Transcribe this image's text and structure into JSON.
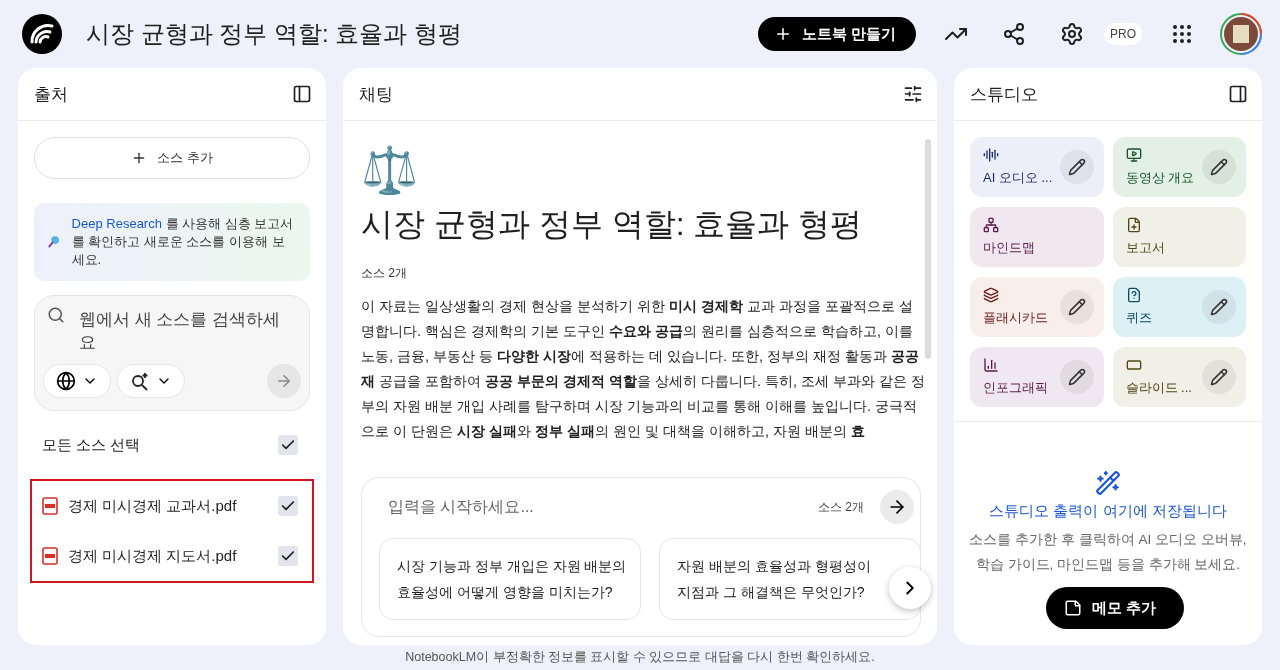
{
  "header": {
    "title": "시장 균형과 정부 역할: 효율과 형평",
    "create_button": "노트북 만들기",
    "badge": "PRO"
  },
  "sources_panel": {
    "title": "출처",
    "add_button": "소스 추가",
    "promo": {
      "link": "Deep Research",
      "text": " 를 사용해 심층 보고서를 확인하고 새로운 소스를 이용해 보세요."
    },
    "search": {
      "placeholder": "웹에서 새 소스를 검색하세요"
    },
    "select_all": {
      "label": "모든 소스 선택",
      "checked": true
    },
    "highlighted": true,
    "sources": [
      {
        "name": "경제 미시경제 교과서.pdf",
        "checked": true
      },
      {
        "name": "경제 미시경제 지도서.pdf",
        "checked": true
      }
    ]
  },
  "chat_panel": {
    "title": "채팅",
    "emoji": "⚖️",
    "notebook_title": "시장 균형과 정부 역할: 효율과 형평",
    "source_count": "소스 2개",
    "summary": "이 자료는 일상생활의 경제 현상을 분석하기 위한 **미시 경제학** 교과 과정을 포괄적으로 설명합니다. 핵심은 경제학의 기본 도구인 **수요와 공급**의 원리를 심층적으로 학습하고, 이를 노동, 금융, 부동산 등 **다양한 시장**에 적용하는 데 있습니다. 또한, 정부의 재정 활동과 **공공재** 공급을 포함하여 **공공 부문의 경제적 역할**을 상세히 다룹니다. 특히, 조세 부과와 같은 정부의 자원 배분 개입 사례를 탐구하며 시장 기능과의 비교를 통해 이해를 높입니다. 궁극적으로 이 단원은 **시장 실패**와 **정부 실패**의 원인 및 대책을 이해하고, 자원 배분의 **효**",
    "input": {
      "placeholder": "입력을 시작하세요...",
      "source_count": "소스 2개"
    },
    "suggestions": [
      {
        "lines": [
          "시장 기능과 정부 개입은 자원 배분의",
          "효율성에 어떻게 영향을 미치는가?"
        ]
      },
      {
        "lines": [
          "자원 배분의 효율성과 형평성이",
          "지점과 그 해결책은 무엇인가?"
        ]
      }
    ]
  },
  "studio_panel": {
    "title": "스튜디오",
    "tiles": [
      {
        "kind": "audio",
        "label": "AI 오디오 ...",
        "color": "#eceef9",
        "editable": true
      },
      {
        "kind": "video",
        "label": "동영상 개요",
        "color": "#e3f0e5",
        "editable": true
      },
      {
        "kind": "mindmap",
        "label": "마인드맵",
        "color": "#f1e8ef",
        "editable": false
      },
      {
        "kind": "report",
        "label": "보고서",
        "color": "#f1f0e6",
        "editable": false
      },
      {
        "kind": "flashcards",
        "label": "플래시카드",
        "color": "#f8eeea",
        "editable": true
      },
      {
        "kind": "quiz",
        "label": "퀴즈",
        "color": "#ddf0f6",
        "editable": true
      },
      {
        "kind": "infographic",
        "label": "인포그래픽",
        "color": "#f0e8f0",
        "editable": true
      },
      {
        "kind": "slides",
        "label": "슬라이드 ...",
        "color": "#f1f0e6",
        "editable": true
      }
    ],
    "empty_title": "스튜디오 출력이 여기에 저장됩니다",
    "empty_text": "소스를 추가한 후 클릭하여 AI 오디오 오버뷰, 학습 가이드, 마인드맵 등을 추가해 보세요.",
    "memo_button": "메모 추가"
  },
  "footer": "NotebookLM이 부정확한 정보를 표시할 수 있으므로 대답을 다시 한번 확인하세요."
}
